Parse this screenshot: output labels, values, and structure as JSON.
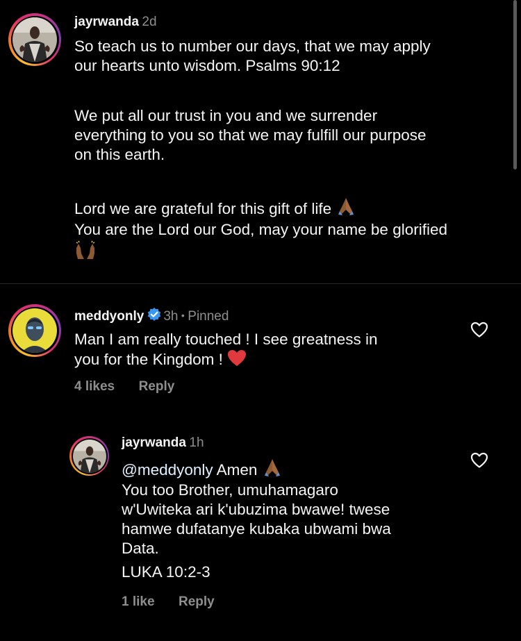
{
  "comments": [
    {
      "username": "jayrwanda",
      "time": "2d",
      "paragraphs": [
        [
          "So teach us to number our days, that we may apply",
          "our hearts unto wisdom. Psalms 90:12"
        ],
        [
          "We put all our trust in you and we surrender",
          "everything to you so that we may fulfill our purpose",
          "on this earth."
        ],
        [
          "Lord we are grateful for this gift of life"
        ],
        [
          "You are the Lord our God, may your name be glorified"
        ]
      ]
    },
    {
      "username": "meddyonly",
      "time": "3h",
      "separator": "•",
      "pinned": "Pinned",
      "lines": [
        "Man I am really touched ! I see greatness in",
        "you for the Kingdom !"
      ],
      "likes": "4 likes",
      "reply": "Reply"
    },
    {
      "username": "jayrwanda",
      "time": "1h",
      "mention": "@meddyonly",
      "first_line_rest": " Amen",
      "lines": [
        "You too Brother, umuhamagaro",
        "w'Uwiteka ari k'ubuzima bwawe! twese",
        "hamwe dufatanye kubaka ubwami bwa",
        "Data."
      ],
      "extra_line": "LUKA 10:2-3",
      "likes": "1 like",
      "reply": "Reply"
    }
  ],
  "icons": {
    "like": "heart-outline-icon",
    "verified": "verified-badge-icon",
    "praying_hands": "folded-hands-emoji",
    "raising_hands": "raising-hands-emoji",
    "red_heart": "red-heart-emoji"
  },
  "colors": {
    "background": "#000000",
    "text": "#f5f5f5",
    "muted": "#8e8e8e",
    "verified": "#3897f0",
    "heart_emoji": "#e0393e"
  }
}
